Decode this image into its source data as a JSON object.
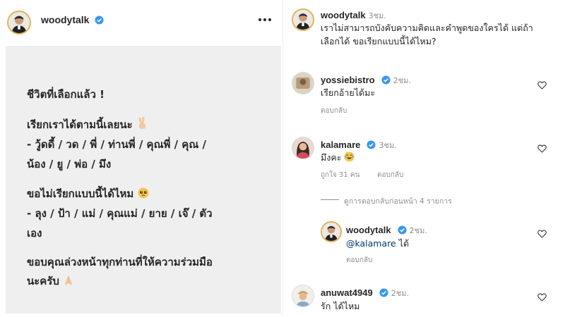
{
  "post": {
    "username": "woodytalk",
    "lines": [
      "ชีวิตที่เลือกแล้ว !",
      "เรียกเราได้ตามนี้เลยนะ",
      "- วู้ดดี้ / วด / พี่ / ท่านพี่ / คุณพี่ / คุณ /",
      "น้อง / ยู / พ่อ / มึง",
      "ขอไม่เรียกแบบนี้ได้ไหม",
      "- ลุง / ป้า / แม่ / คุณแม่ / ยาย / เจ๊ / ตัว",
      "เอง",
      "ขอบคุณล่วงหน้าทุกท่านที่ให้ความร่วมมือ",
      "นะครับ"
    ],
    "icons": [
      "verified-icon",
      "more-options-icon",
      "victory-hand-emoji",
      "pleading-face-emoji",
      "folded-hands-emoji"
    ]
  },
  "caption": {
    "username": "woodytalk",
    "time": "3ชม.",
    "text_line1": "เราไม่สามารถบังคับความคิดและคำพูดของใครได้ แต่ถ้า",
    "text_line2": "เลือกได้ ขอเรียกแบบนี้ได้ไหม?"
  },
  "comments": [
    {
      "username": "yossiebistro",
      "time": "2ชม.",
      "text": "เรียกอ้ายได้มะ",
      "reply": "ตอบกลับ"
    },
    {
      "username": "kalamare",
      "time": "3ชม.",
      "text": "มึงคะ",
      "likes": "ถูกใจ 31 คน",
      "reply": "ตอบกลับ"
    },
    {
      "view_replies": "ดูการตอบกลับก่อนหน้า 4 รายการ"
    },
    {
      "username": "woodytalk",
      "time": "2ชม.",
      "mention": "@kalamare",
      "text": " ได้",
      "reply": "ตอบกลับ"
    },
    {
      "username": "anuwat4949",
      "time": "2ชม.",
      "text": "รัก ได้ไหม"
    }
  ],
  "colors": {
    "verified": "#3897f0",
    "muted": "#8e8e8e",
    "mention": "#00376b",
    "post_bg": "#efefef"
  }
}
